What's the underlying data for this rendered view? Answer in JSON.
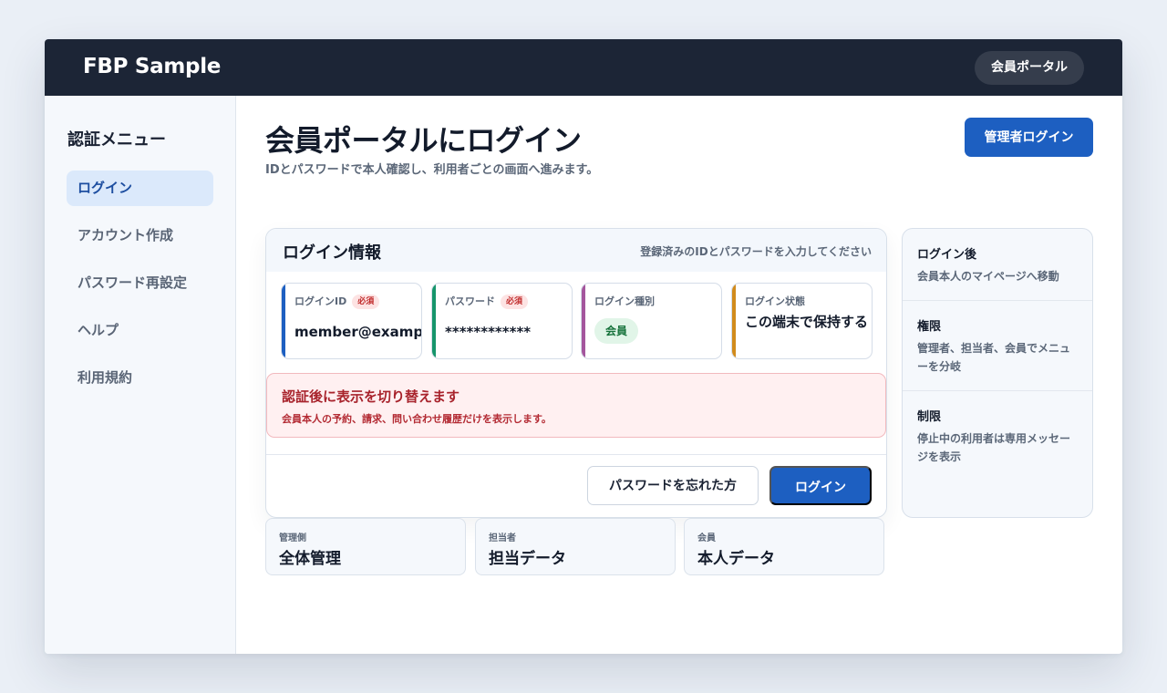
{
  "header": {
    "brand": "FBP Sample",
    "portal_label": "会員ポータル"
  },
  "sidebar": {
    "title": "認証メニュー",
    "items": [
      {
        "label": "ログイン",
        "active": true
      },
      {
        "label": "アカウント作成"
      },
      {
        "label": "パスワード再設定"
      },
      {
        "label": "ヘルプ"
      },
      {
        "label": "利用規約"
      }
    ]
  },
  "page": {
    "title": "会員ポータルにログイン",
    "subtitle": "IDとパスワードで本人確認し、利用者ごとの画面へ進みます。",
    "admin_button": "管理者ログイン"
  },
  "login_card": {
    "title": "ログイン情報",
    "hint": "登録済みのIDとパスワードを入力してください",
    "fields": [
      {
        "label": "ログインID",
        "required": "必須",
        "value": "member@example.",
        "accent": "#1d5fc1"
      },
      {
        "label": "パスワード",
        "required": "必須",
        "value": "************",
        "accent": "#16956b"
      },
      {
        "label": "ログイン種別",
        "value": "会員",
        "accent": "#a4569d"
      },
      {
        "label": "ログイン状態",
        "value": "この端末で保持する",
        "accent": "#d18b1c"
      }
    ],
    "alert": {
      "title": "認証後に表示を切り替えます",
      "text": "会員本人の予約、請求、問い合わせ履歴だけを表示します。"
    },
    "forgot_button": "パスワードを忘れた方",
    "login_button": "ログイン"
  },
  "stats": [
    {
      "label": "管理側",
      "value": "全体管理"
    },
    {
      "label": "担当者",
      "value": "担当データ"
    },
    {
      "label": "会員",
      "value": "本人データ"
    }
  ],
  "info_panel": [
    {
      "title": "ログイン後",
      "text": "会員本人のマイページへ移動"
    },
    {
      "title": "権限",
      "text": "管理者、担当者、会員でメニューを分岐"
    },
    {
      "title": "制限",
      "text": "停止中の利用者は専用メッセージを表示"
    }
  ],
  "colors": {
    "topbar": "#1c2536",
    "primary": "#1d5fc1",
    "alert_bg": "#fff0f1",
    "alert_text": "#a8232c"
  }
}
